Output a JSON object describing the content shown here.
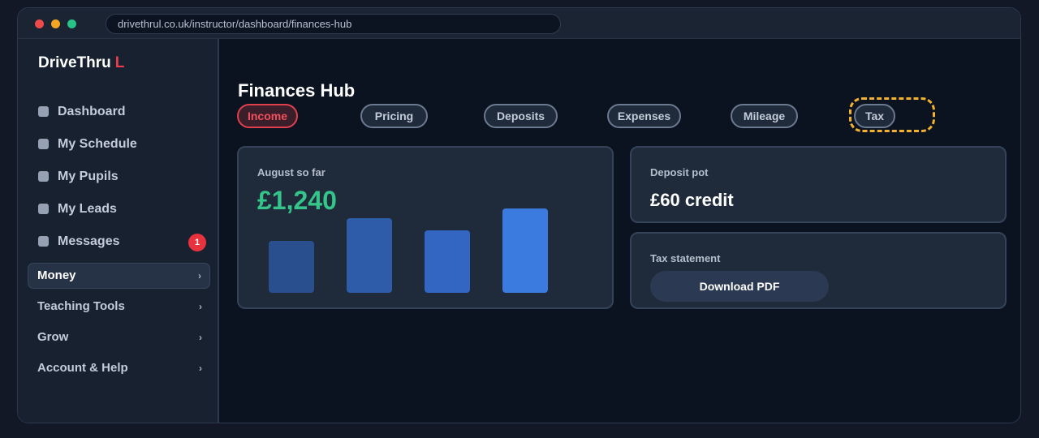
{
  "browser": {
    "url": "drivethrul.co.uk/instructor/dashboard/finances-hub"
  },
  "sidebar": {
    "logo_main": "DriveThru",
    "logo_accent": "L",
    "items": [
      {
        "label": "Dashboard"
      },
      {
        "label": "My Schedule"
      },
      {
        "label": "My Pupils"
      },
      {
        "label": "My Leads"
      },
      {
        "label": "Messages",
        "badge": "1"
      }
    ],
    "groups": [
      {
        "label": "Money",
        "chevron": "›",
        "active": true
      },
      {
        "label": "Teaching Tools",
        "chevron": "›"
      },
      {
        "label": "Grow",
        "chevron": "›"
      },
      {
        "label": "Account & Help",
        "chevron": "›"
      }
    ]
  },
  "main": {
    "title": "Finances Hub",
    "tabs": [
      {
        "label": "Income",
        "active": true
      },
      {
        "label": "Pricing"
      },
      {
        "label": "Deposits"
      },
      {
        "label": "Expenses"
      },
      {
        "label": "Mileage"
      },
      {
        "label": "Tax",
        "highlighted": true
      }
    ],
    "income_card": {
      "label": "August so far",
      "amount": "£1,240",
      "bars": [
        {
          "value": 0.62,
          "color": "#2a4f8f"
        },
        {
          "value": 0.88,
          "color": "#2f5ca8"
        },
        {
          "value": 0.74,
          "color": "#3366c2"
        },
        {
          "value": 1.0,
          "color": "#3b7be0"
        }
      ]
    },
    "deposit_card": {
      "label": "Deposit pot",
      "value": "£60 credit"
    },
    "tax_card": {
      "label": "Tax statement",
      "button": "Download PDF"
    }
  },
  "colors": {
    "accent_red": "#e0404e",
    "income_green": "#35c48a",
    "highlight_yellow": "#f2b230"
  }
}
